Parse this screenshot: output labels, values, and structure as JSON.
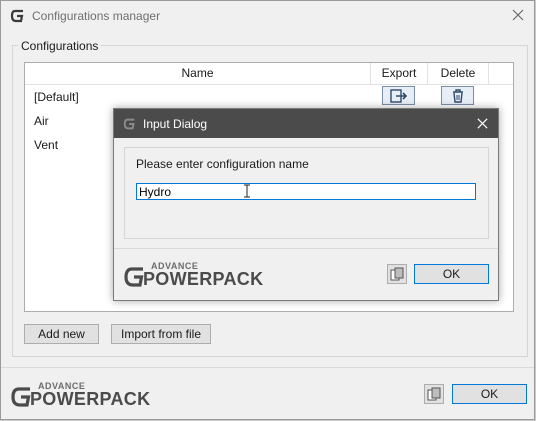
{
  "main_window": {
    "title": "Configurations manager",
    "group_label": "Configurations",
    "columns": {
      "name": "Name",
      "export": "Export",
      "delete": "Delete"
    },
    "rows": [
      {
        "name": "[Default]"
      },
      {
        "name": "Air"
      },
      {
        "name": "Vent"
      }
    ],
    "add_new_label": "Add new",
    "import_label": "Import from file",
    "ok_label": "OK"
  },
  "logo": {
    "small": "ADVANCE",
    "big": "POWERPACK"
  },
  "dialog": {
    "title": "Input Dialog",
    "prompt": "Please enter configuration name",
    "input_value": "Hydro",
    "ok_label": "OK"
  },
  "colors": {
    "window_bg": "#f0f0f0",
    "dialog_title_bg": "#4b4b4b",
    "focus_blue": "#0078d7",
    "button_bg": "#e1e1e1"
  },
  "icons": [
    "app-logo-icon",
    "close-icon",
    "export-icon",
    "delete-icon",
    "document-icon",
    "text-cursor-icon"
  ]
}
